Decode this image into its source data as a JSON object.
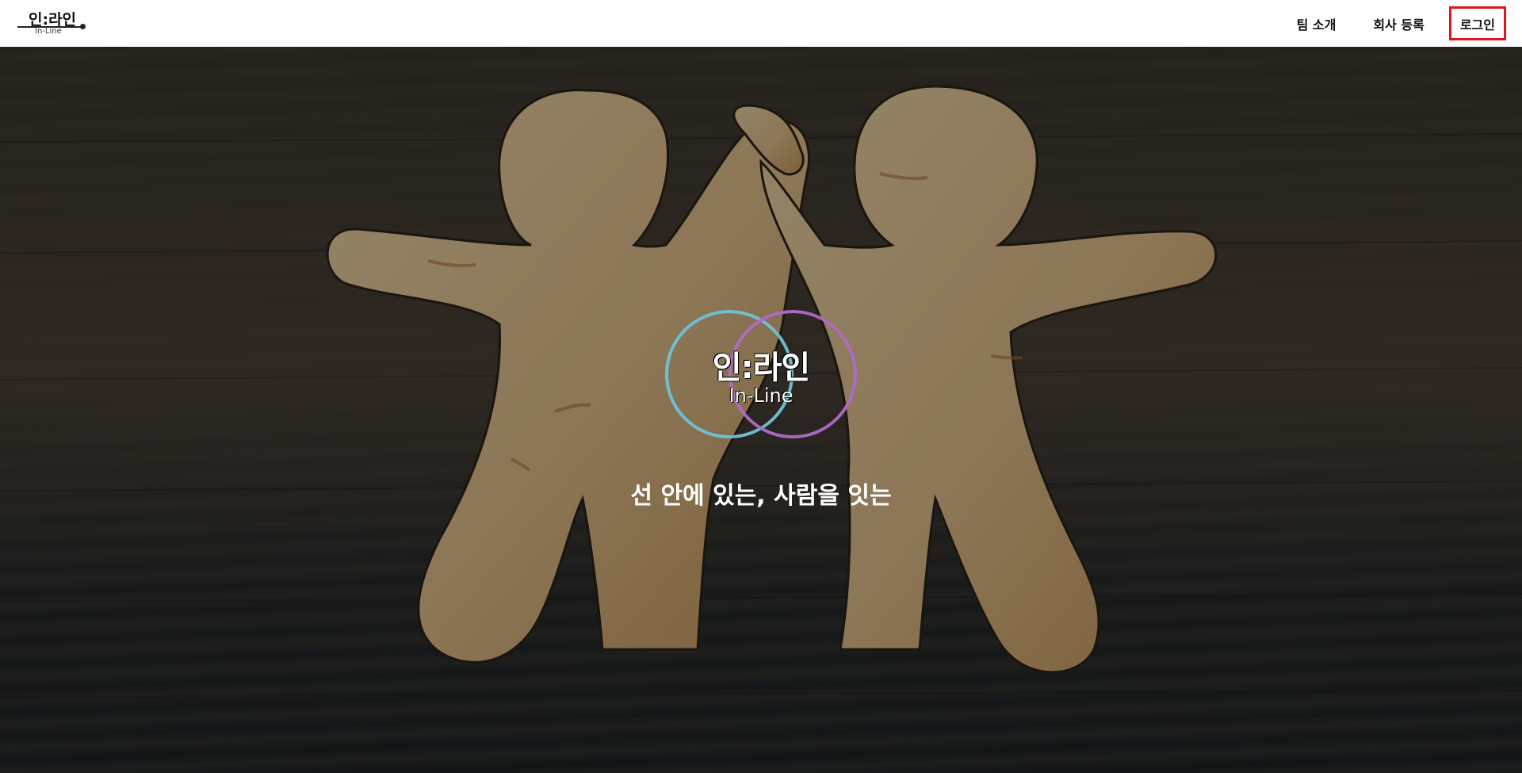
{
  "header": {
    "logo": {
      "korean": "인:라인",
      "english": "In-Line"
    },
    "nav": {
      "team_intro": "팀 소개",
      "company_register": "회사 등록",
      "login": "로그인"
    }
  },
  "hero": {
    "logo": {
      "korean": "인:라인",
      "english": "In-Line"
    },
    "tagline": "선 안에 있는, 사람을 잇는"
  },
  "colors": {
    "login_highlight": "#e0161e",
    "ring_left": "#6fc2d8",
    "ring_right": "#b06ac6",
    "wood": "#e6c99a"
  },
  "icons": {
    "background": "wooden-figures-image"
  }
}
